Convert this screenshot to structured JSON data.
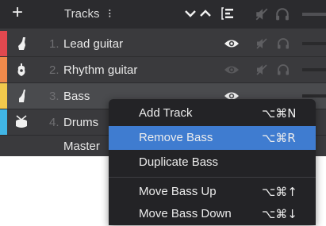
{
  "header": {
    "add_label": "+",
    "title": "Tracks",
    "more_label": "⁝"
  },
  "tracks": [
    {
      "num": "1.",
      "name": "Lead guitar",
      "color": "#e1484f",
      "icon": "electric-guitar-icon",
      "visible": true
    },
    {
      "num": "2.",
      "name": "Rhythm guitar",
      "color": "#f08a4b",
      "icon": "acoustic-guitar-icon",
      "visible": false
    },
    {
      "num": "3.",
      "name": "Bass",
      "color": "#f2c94c",
      "icon": "bass-guitar-icon",
      "visible": true
    },
    {
      "num": "4.",
      "name": "Drums",
      "color": "#41b6e6",
      "icon": "drums-icon",
      "visible": false
    }
  ],
  "master": {
    "name": "Master"
  },
  "context_menu": {
    "items": [
      {
        "label": "Add Track",
        "shortcut": "⌥⌘N"
      },
      {
        "label": "Remove Bass",
        "shortcut": "⌥⌘R"
      },
      {
        "label": "Duplicate Bass",
        "shortcut": ""
      },
      {
        "label": "Move Bass Up",
        "shortcut": "⌥⌘↑"
      },
      {
        "label": "Move Bass Down",
        "shortcut": "⌥⌘↓"
      }
    ],
    "highlighted_index": 1
  },
  "colors": {
    "highlight": "#3f7cd0",
    "panel": "#3a3a3d",
    "header": "#2b2b2e"
  }
}
